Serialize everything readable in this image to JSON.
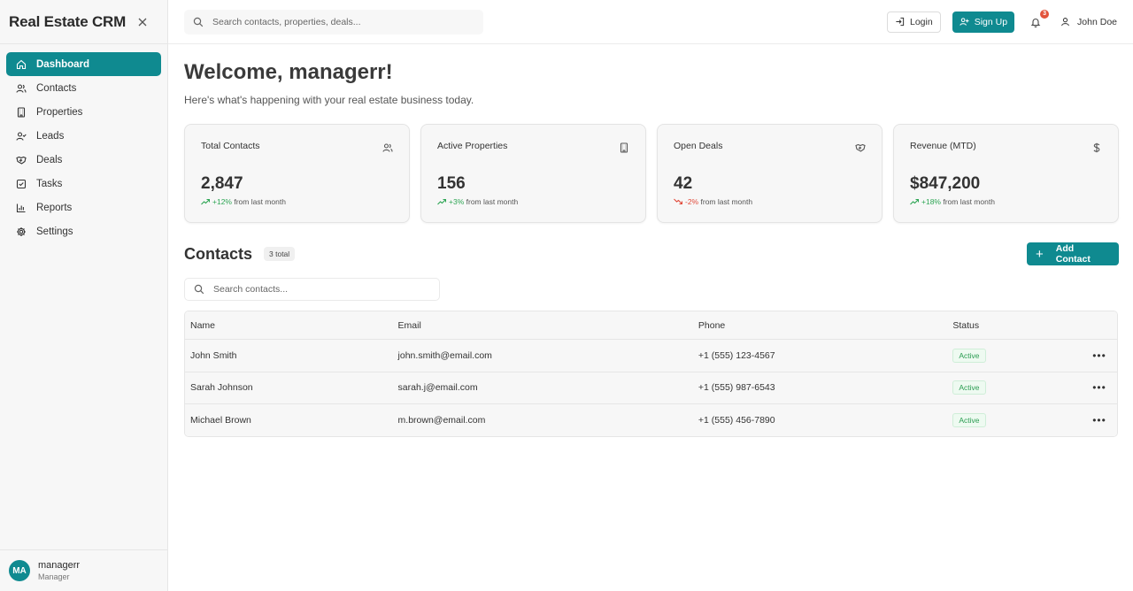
{
  "sidebar": {
    "title": "Real Estate CRM",
    "items": [
      {
        "label": "Dashboard",
        "icon": "home-icon",
        "active": true
      },
      {
        "label": "Contacts",
        "icon": "users-icon"
      },
      {
        "label": "Properties",
        "icon": "building-icon"
      },
      {
        "label": "Leads",
        "icon": "user-check-icon"
      },
      {
        "label": "Deals",
        "icon": "handshake-icon"
      },
      {
        "label": "Tasks",
        "icon": "checkbox-icon"
      },
      {
        "label": "Reports",
        "icon": "bar-chart-icon"
      },
      {
        "label": "Settings",
        "icon": "gear-icon"
      }
    ],
    "user": {
      "initials": "MA",
      "name": "managerr",
      "role": "Manager"
    }
  },
  "topbar": {
    "search_placeholder": "Search contacts, properties, deals...",
    "login_label": "Login",
    "signup_label": "Sign Up",
    "notification_count": "3",
    "user_name": "John Doe"
  },
  "main": {
    "welcome": "Welcome, managerr!",
    "subtitle": "Here's what's happening with your real estate business today.",
    "cards": [
      {
        "title": "Total Contacts",
        "value": "2,847",
        "change": "+12%",
        "change_suffix": "from last month",
        "trend": "up",
        "icon": "users-icon"
      },
      {
        "title": "Active Properties",
        "value": "156",
        "change": "+3%",
        "change_suffix": "from last month",
        "trend": "up",
        "icon": "building-icon"
      },
      {
        "title": "Open Deals",
        "value": "42",
        "change": "-2%",
        "change_suffix": "from last month",
        "trend": "down",
        "icon": "handshake-icon"
      },
      {
        "title": "Revenue (MTD)",
        "value": "$847,200",
        "change": "+18%",
        "change_suffix": "from last month",
        "trend": "up",
        "icon": "dollar-icon"
      }
    ],
    "contacts": {
      "title": "Contacts",
      "total": "3 total",
      "add_label": "Add Contact",
      "search_placeholder": "Search contacts...",
      "columns": [
        "Name",
        "Email",
        "Phone",
        "Status"
      ],
      "rows": [
        {
          "name": "John Smith",
          "email": "john.smith@email.com",
          "phone": "+1 (555) 123-4567",
          "status": "Active"
        },
        {
          "name": "Sarah Johnson",
          "email": "sarah.j@email.com",
          "phone": "+1 (555) 987-6543",
          "status": "Active"
        },
        {
          "name": "Michael Brown",
          "email": "m.brown@email.com",
          "phone": "+1 (555) 456-7890",
          "status": "Active"
        }
      ]
    }
  },
  "colors": {
    "accent": "#0f8a90",
    "positive": "#2fa655",
    "negative": "#e14a3a",
    "badge": "#e2533b"
  }
}
